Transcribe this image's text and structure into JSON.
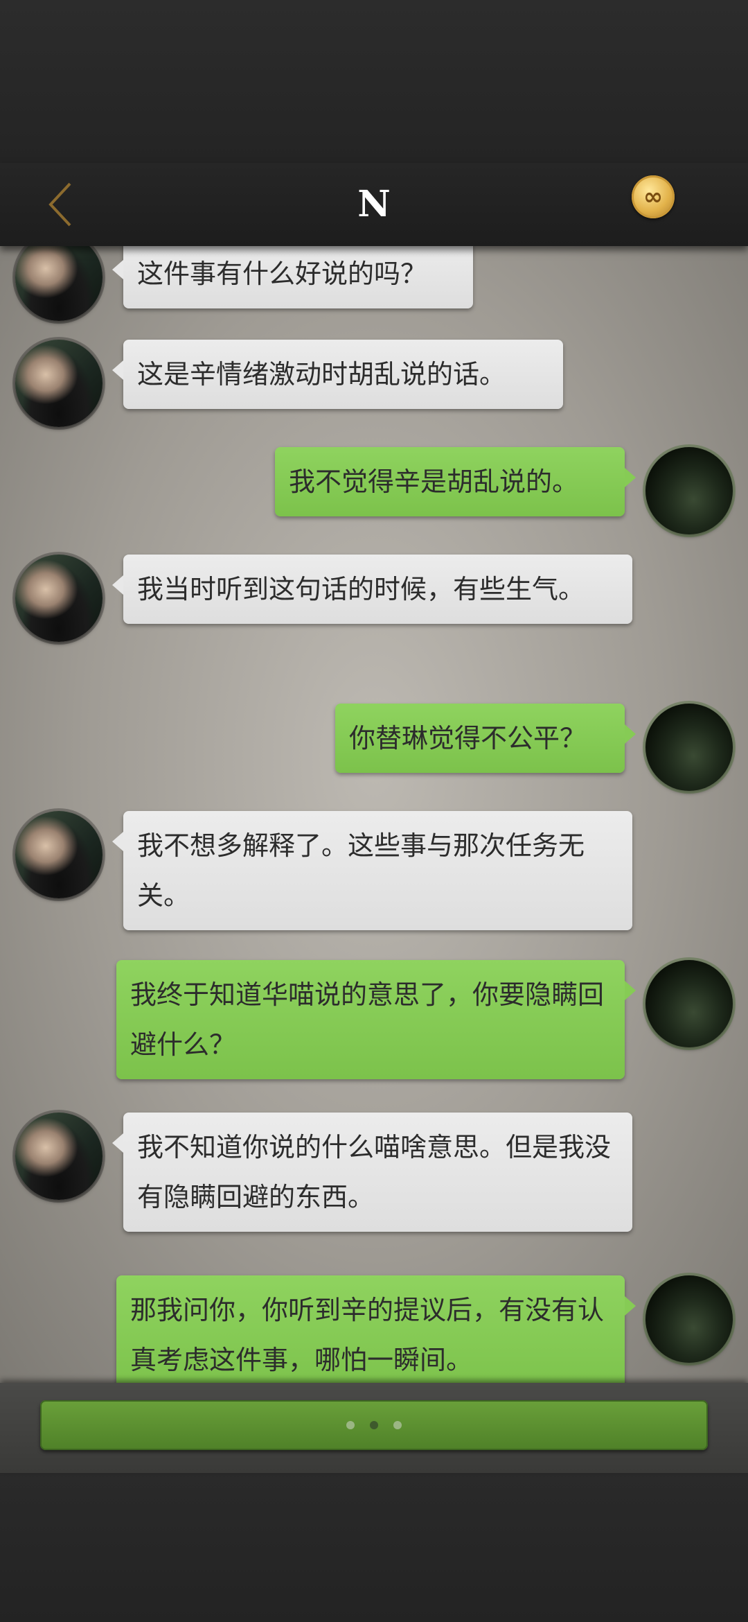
{
  "header": {
    "title": "N",
    "colors": {
      "back_chevron": "#8c6b2e",
      "coin": "#e2b24a"
    }
  },
  "chat": {
    "messages": [
      {
        "side": "left",
        "text": "这件事有什么好说的吗？"
      },
      {
        "side": "left",
        "text": "这是辛情绪激动时胡乱说的话。"
      },
      {
        "side": "right",
        "text": "我不觉得辛是胡乱说的。"
      },
      {
        "side": "left",
        "text": "我当时听到这句话的时候，有些生气。"
      },
      {
        "side": "right",
        "text": "你替琳觉得不公平？"
      },
      {
        "side": "left",
        "text": "我不想多解释了。这些事与那次任务无关。"
      },
      {
        "side": "right",
        "text": "我终于知道华喵说的意思了，你要隐瞒回避什么？"
      },
      {
        "side": "left",
        "text": "我不知道你说的什么喵啥意思。但是我没有隐瞒回避的东西。"
      },
      {
        "side": "right",
        "text": "那我问你，你听到辛的提议后，有没有认真考虑这件事，哪怕一瞬间。"
      }
    ],
    "colors": {
      "left_bubble": "#e6e6e6",
      "right_bubble": "#86cb55"
    }
  },
  "input_bar": {
    "dots": 3,
    "active_dot": 2,
    "color": "#5e9232"
  }
}
